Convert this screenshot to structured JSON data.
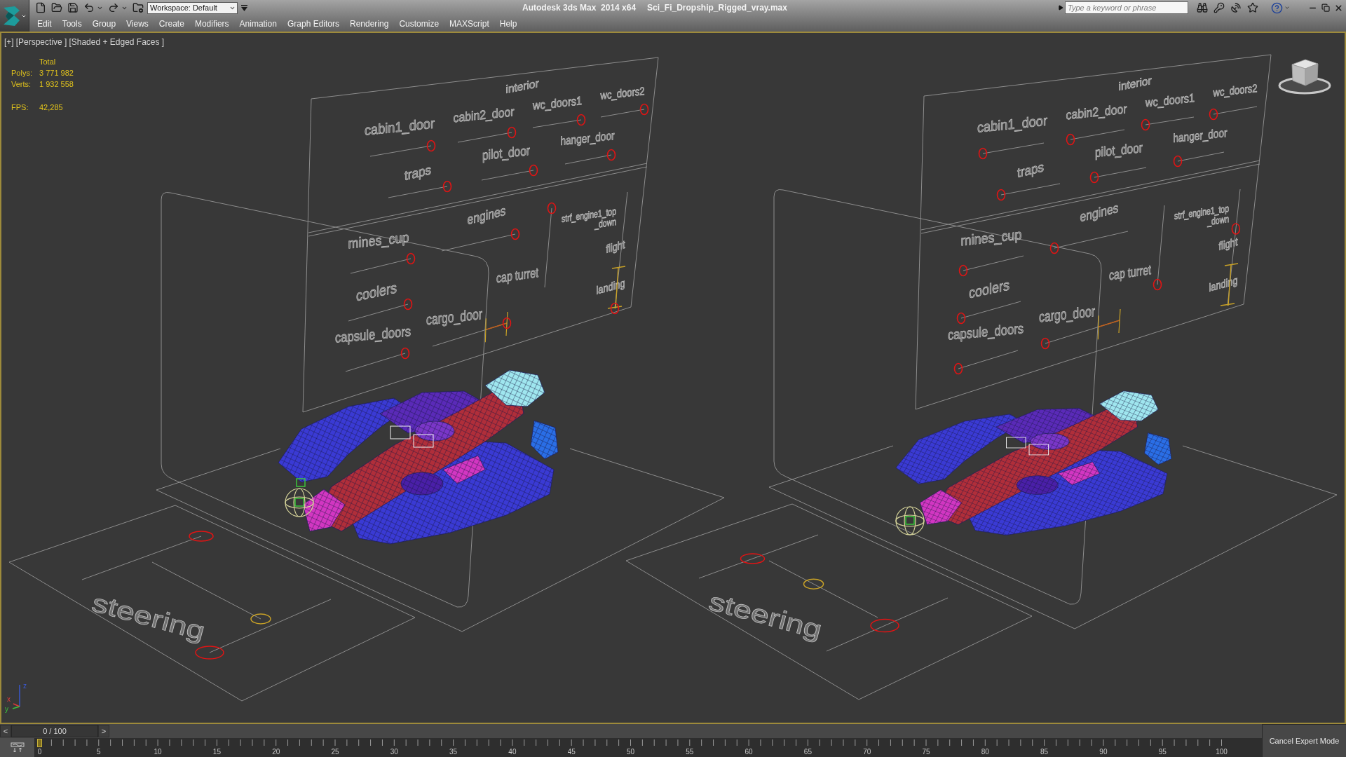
{
  "title_bar": {
    "workspace": "Workspace: Default",
    "app_name": "Autodesk 3ds Max  2014 x64",
    "file_name": "Sci_Fi_Dropship_Rigged_vray.max",
    "search": {
      "placeholder": "Type a keyword or phrase"
    }
  },
  "menu": [
    "Edit",
    "Tools",
    "Group",
    "Views",
    "Create",
    "Modifiers",
    "Animation",
    "Graph Editors",
    "Rendering",
    "Customize",
    "MAXScript",
    "Help"
  ],
  "viewport": {
    "labels": [
      "[+]",
      "[Perspective ]",
      "[Shaded + Edged Faces ]"
    ],
    "stats": {
      "heading": "Total",
      "rows": [
        {
          "label": "Polys:",
          "value": "3 771 982"
        },
        {
          "label": "Verts:",
          "value": "1 932 558"
        },
        {
          "label": "FPS:",
          "value": "42,285"
        }
      ]
    },
    "rigs": [
      {
        "controls": [
          {
            "kind": "heading",
            "label": "interior"
          },
          {
            "kind": "slider",
            "label": "cabin1_door",
            "level": 1
          },
          {
            "kind": "slider",
            "label": "cabin2_door",
            "level": 1
          },
          {
            "kind": "slider",
            "label": "wc_doors1",
            "level": 1
          },
          {
            "kind": "slider",
            "label": "wc_doors2",
            "level": 1
          },
          {
            "kind": "slider",
            "label": "traps",
            "level": 1
          },
          {
            "kind": "slider",
            "label": "pilot_door",
            "level": 1
          },
          {
            "kind": "slider",
            "label": "hanger_door",
            "level": 1
          },
          {
            "kind": "slider",
            "label": "engines",
            "level": 1
          },
          {
            "kind": "label",
            "lines": [
              "strf_engine1_top",
              "_down"
            ]
          },
          {
            "kind": "slider",
            "label": "mines_cup",
            "level": 1
          },
          {
            "kind": "vslider",
            "label": "cap turret",
            "level": 1
          },
          {
            "kind": "label",
            "label": "flight"
          },
          {
            "kind": "label",
            "label": "landing"
          },
          {
            "kind": "slider",
            "label": "coolers",
            "level": 1
          },
          {
            "kind": "slider",
            "label": "cargo_door",
            "level": 1
          },
          {
            "kind": "slider",
            "label": "capsule_doors",
            "level": 1
          }
        ],
        "mode_slider": {
          "level": 0
        },
        "floor": {
          "label": "steering",
          "sliders": [
            {
              "color": "#e01414",
              "level": 1
            },
            {
              "color": "#c9a227",
              "level": 1
            },
            {
              "color": "#e01414",
              "level": 0
            }
          ]
        }
      },
      {
        "controls": [
          {
            "kind": "heading",
            "label": "interior"
          },
          {
            "kind": "slider",
            "label": "cabin1_door",
            "level": 0
          },
          {
            "kind": "slider",
            "label": "cabin2_door",
            "level": 0
          },
          {
            "kind": "slider",
            "label": "wc_doors1",
            "level": 0
          },
          {
            "kind": "slider",
            "label": "wc_doors2",
            "level": 0
          },
          {
            "kind": "slider",
            "label": "traps",
            "level": 0
          },
          {
            "kind": "slider",
            "label": "pilot_door",
            "level": 0
          },
          {
            "kind": "slider",
            "label": "hanger_door",
            "level": 0
          },
          {
            "kind": "slider",
            "label": "engines",
            "level": 0
          },
          {
            "kind": "label",
            "lines": [
              "strf_engine1_top",
              "_down"
            ]
          },
          {
            "kind": "slider",
            "label": "mines_cup",
            "level": 0
          },
          {
            "kind": "vslider",
            "label": "cap turret",
            "level": 0
          },
          {
            "kind": "label",
            "label": "flight"
          },
          {
            "kind": "label",
            "label": "landing"
          },
          {
            "kind": "slider",
            "label": "coolers",
            "level": 0
          },
          {
            "kind": "slider",
            "label": "cargo_door",
            "level": 0
          },
          {
            "kind": "slider",
            "label": "capsule_doors",
            "level": 0
          }
        ],
        "mode_slider": {
          "level": 0.66
        },
        "floor": {
          "label": "steering",
          "sliders": [
            {
              "color": "#e01414",
              "level": 0.45
            },
            {
              "color": "#c9a227",
              "level": 0.41
            },
            {
              "color": "#e01414",
              "level": 0.48
            }
          ]
        }
      }
    ],
    "axes": [
      "z",
      "x",
      "y"
    ]
  },
  "timeline": {
    "prev": "<",
    "frame": "0 / 100",
    "next": ">",
    "level": 0,
    "ticks": [
      "0",
      "5",
      "10",
      "15",
      "20",
      "25",
      "30",
      "35",
      "40",
      "45",
      "50",
      "55",
      "60",
      "65",
      "70",
      "75",
      "80",
      "85",
      "90",
      "95",
      "100"
    ],
    "expert_button": "Cancel Expert Mode"
  }
}
